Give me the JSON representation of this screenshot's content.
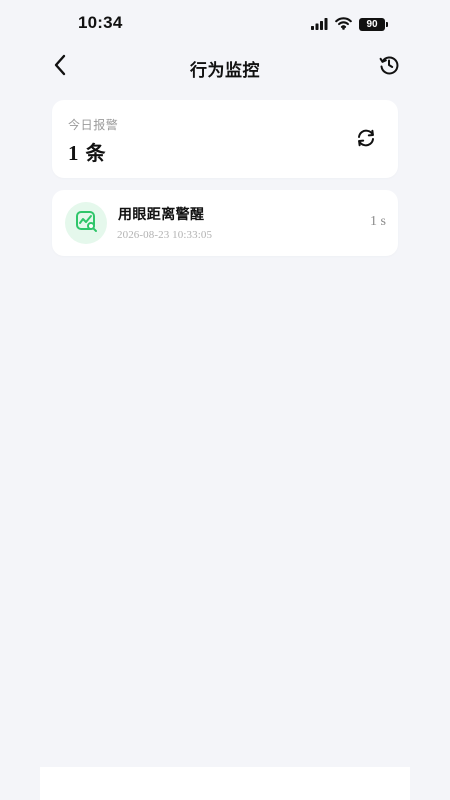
{
  "status_bar": {
    "time": "10:34",
    "signal_icon": "cellular-signal-icon",
    "wifi_icon": "wifi-icon",
    "battery_percent": 90
  },
  "nav": {
    "back_icon": "chevron-left-icon",
    "title": "行为监控",
    "history_icon": "history-icon"
  },
  "summary": {
    "label": "今日报警",
    "count": "1",
    "unit": "条",
    "refresh_icon": "refresh-icon"
  },
  "alerts": [
    {
      "icon": "eye-distance-alert-icon",
      "title": "用眼距离警醒",
      "time": "2026-08-23 10:33:05",
      "duration": "1 s"
    }
  ],
  "colors": {
    "background": "#f4f5f9",
    "card": "#ffffff",
    "text_primary": "#111111",
    "text_secondary": "#9a9a9a",
    "accent_green": "#2fc66a",
    "icon_bg_green": "#e5f8ec"
  }
}
